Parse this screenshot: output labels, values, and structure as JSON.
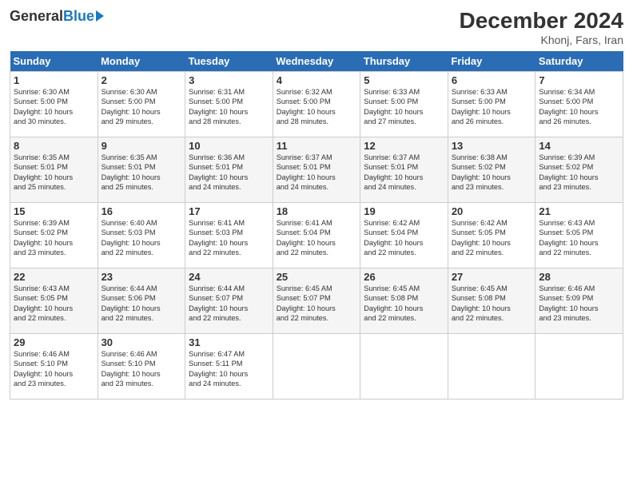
{
  "logo": {
    "general": "General",
    "blue": "Blue"
  },
  "title": "December 2024",
  "location": "Khonj, Fars, Iran",
  "days_of_week": [
    "Sunday",
    "Monday",
    "Tuesday",
    "Wednesday",
    "Thursday",
    "Friday",
    "Saturday"
  ],
  "weeks": [
    [
      {
        "day": "1",
        "info": "Sunrise: 6:30 AM\nSunset: 5:00 PM\nDaylight: 10 hours\nand 30 minutes."
      },
      {
        "day": "2",
        "info": "Sunrise: 6:30 AM\nSunset: 5:00 PM\nDaylight: 10 hours\nand 29 minutes."
      },
      {
        "day": "3",
        "info": "Sunrise: 6:31 AM\nSunset: 5:00 PM\nDaylight: 10 hours\nand 28 minutes."
      },
      {
        "day": "4",
        "info": "Sunrise: 6:32 AM\nSunset: 5:00 PM\nDaylight: 10 hours\nand 28 minutes."
      },
      {
        "day": "5",
        "info": "Sunrise: 6:33 AM\nSunset: 5:00 PM\nDaylight: 10 hours\nand 27 minutes."
      },
      {
        "day": "6",
        "info": "Sunrise: 6:33 AM\nSunset: 5:00 PM\nDaylight: 10 hours\nand 26 minutes."
      },
      {
        "day": "7",
        "info": "Sunrise: 6:34 AM\nSunset: 5:00 PM\nDaylight: 10 hours\nand 26 minutes."
      }
    ],
    [
      {
        "day": "8",
        "info": "Sunrise: 6:35 AM\nSunset: 5:01 PM\nDaylight: 10 hours\nand 25 minutes."
      },
      {
        "day": "9",
        "info": "Sunrise: 6:35 AM\nSunset: 5:01 PM\nDaylight: 10 hours\nand 25 minutes."
      },
      {
        "day": "10",
        "info": "Sunrise: 6:36 AM\nSunset: 5:01 PM\nDaylight: 10 hours\nand 24 minutes."
      },
      {
        "day": "11",
        "info": "Sunrise: 6:37 AM\nSunset: 5:01 PM\nDaylight: 10 hours\nand 24 minutes."
      },
      {
        "day": "12",
        "info": "Sunrise: 6:37 AM\nSunset: 5:01 PM\nDaylight: 10 hours\nand 24 minutes."
      },
      {
        "day": "13",
        "info": "Sunrise: 6:38 AM\nSunset: 5:02 PM\nDaylight: 10 hours\nand 23 minutes."
      },
      {
        "day": "14",
        "info": "Sunrise: 6:39 AM\nSunset: 5:02 PM\nDaylight: 10 hours\nand 23 minutes."
      }
    ],
    [
      {
        "day": "15",
        "info": "Sunrise: 6:39 AM\nSunset: 5:02 PM\nDaylight: 10 hours\nand 23 minutes."
      },
      {
        "day": "16",
        "info": "Sunrise: 6:40 AM\nSunset: 5:03 PM\nDaylight: 10 hours\nand 22 minutes."
      },
      {
        "day": "17",
        "info": "Sunrise: 6:41 AM\nSunset: 5:03 PM\nDaylight: 10 hours\nand 22 minutes."
      },
      {
        "day": "18",
        "info": "Sunrise: 6:41 AM\nSunset: 5:04 PM\nDaylight: 10 hours\nand 22 minutes."
      },
      {
        "day": "19",
        "info": "Sunrise: 6:42 AM\nSunset: 5:04 PM\nDaylight: 10 hours\nand 22 minutes."
      },
      {
        "day": "20",
        "info": "Sunrise: 6:42 AM\nSunset: 5:05 PM\nDaylight: 10 hours\nand 22 minutes."
      },
      {
        "day": "21",
        "info": "Sunrise: 6:43 AM\nSunset: 5:05 PM\nDaylight: 10 hours\nand 22 minutes."
      }
    ],
    [
      {
        "day": "22",
        "info": "Sunrise: 6:43 AM\nSunset: 5:05 PM\nDaylight: 10 hours\nand 22 minutes."
      },
      {
        "day": "23",
        "info": "Sunrise: 6:44 AM\nSunset: 5:06 PM\nDaylight: 10 hours\nand 22 minutes."
      },
      {
        "day": "24",
        "info": "Sunrise: 6:44 AM\nSunset: 5:07 PM\nDaylight: 10 hours\nand 22 minutes."
      },
      {
        "day": "25",
        "info": "Sunrise: 6:45 AM\nSunset: 5:07 PM\nDaylight: 10 hours\nand 22 minutes."
      },
      {
        "day": "26",
        "info": "Sunrise: 6:45 AM\nSunset: 5:08 PM\nDaylight: 10 hours\nand 22 minutes."
      },
      {
        "day": "27",
        "info": "Sunrise: 6:45 AM\nSunset: 5:08 PM\nDaylight: 10 hours\nand 22 minutes."
      },
      {
        "day": "28",
        "info": "Sunrise: 6:46 AM\nSunset: 5:09 PM\nDaylight: 10 hours\nand 23 minutes."
      }
    ],
    [
      {
        "day": "29",
        "info": "Sunrise: 6:46 AM\nSunset: 5:10 PM\nDaylight: 10 hours\nand 23 minutes."
      },
      {
        "day": "30",
        "info": "Sunrise: 6:46 AM\nSunset: 5:10 PM\nDaylight: 10 hours\nand 23 minutes."
      },
      {
        "day": "31",
        "info": "Sunrise: 6:47 AM\nSunset: 5:11 PM\nDaylight: 10 hours\nand 24 minutes."
      },
      {
        "day": "",
        "info": ""
      },
      {
        "day": "",
        "info": ""
      },
      {
        "day": "",
        "info": ""
      },
      {
        "day": "",
        "info": ""
      }
    ]
  ]
}
